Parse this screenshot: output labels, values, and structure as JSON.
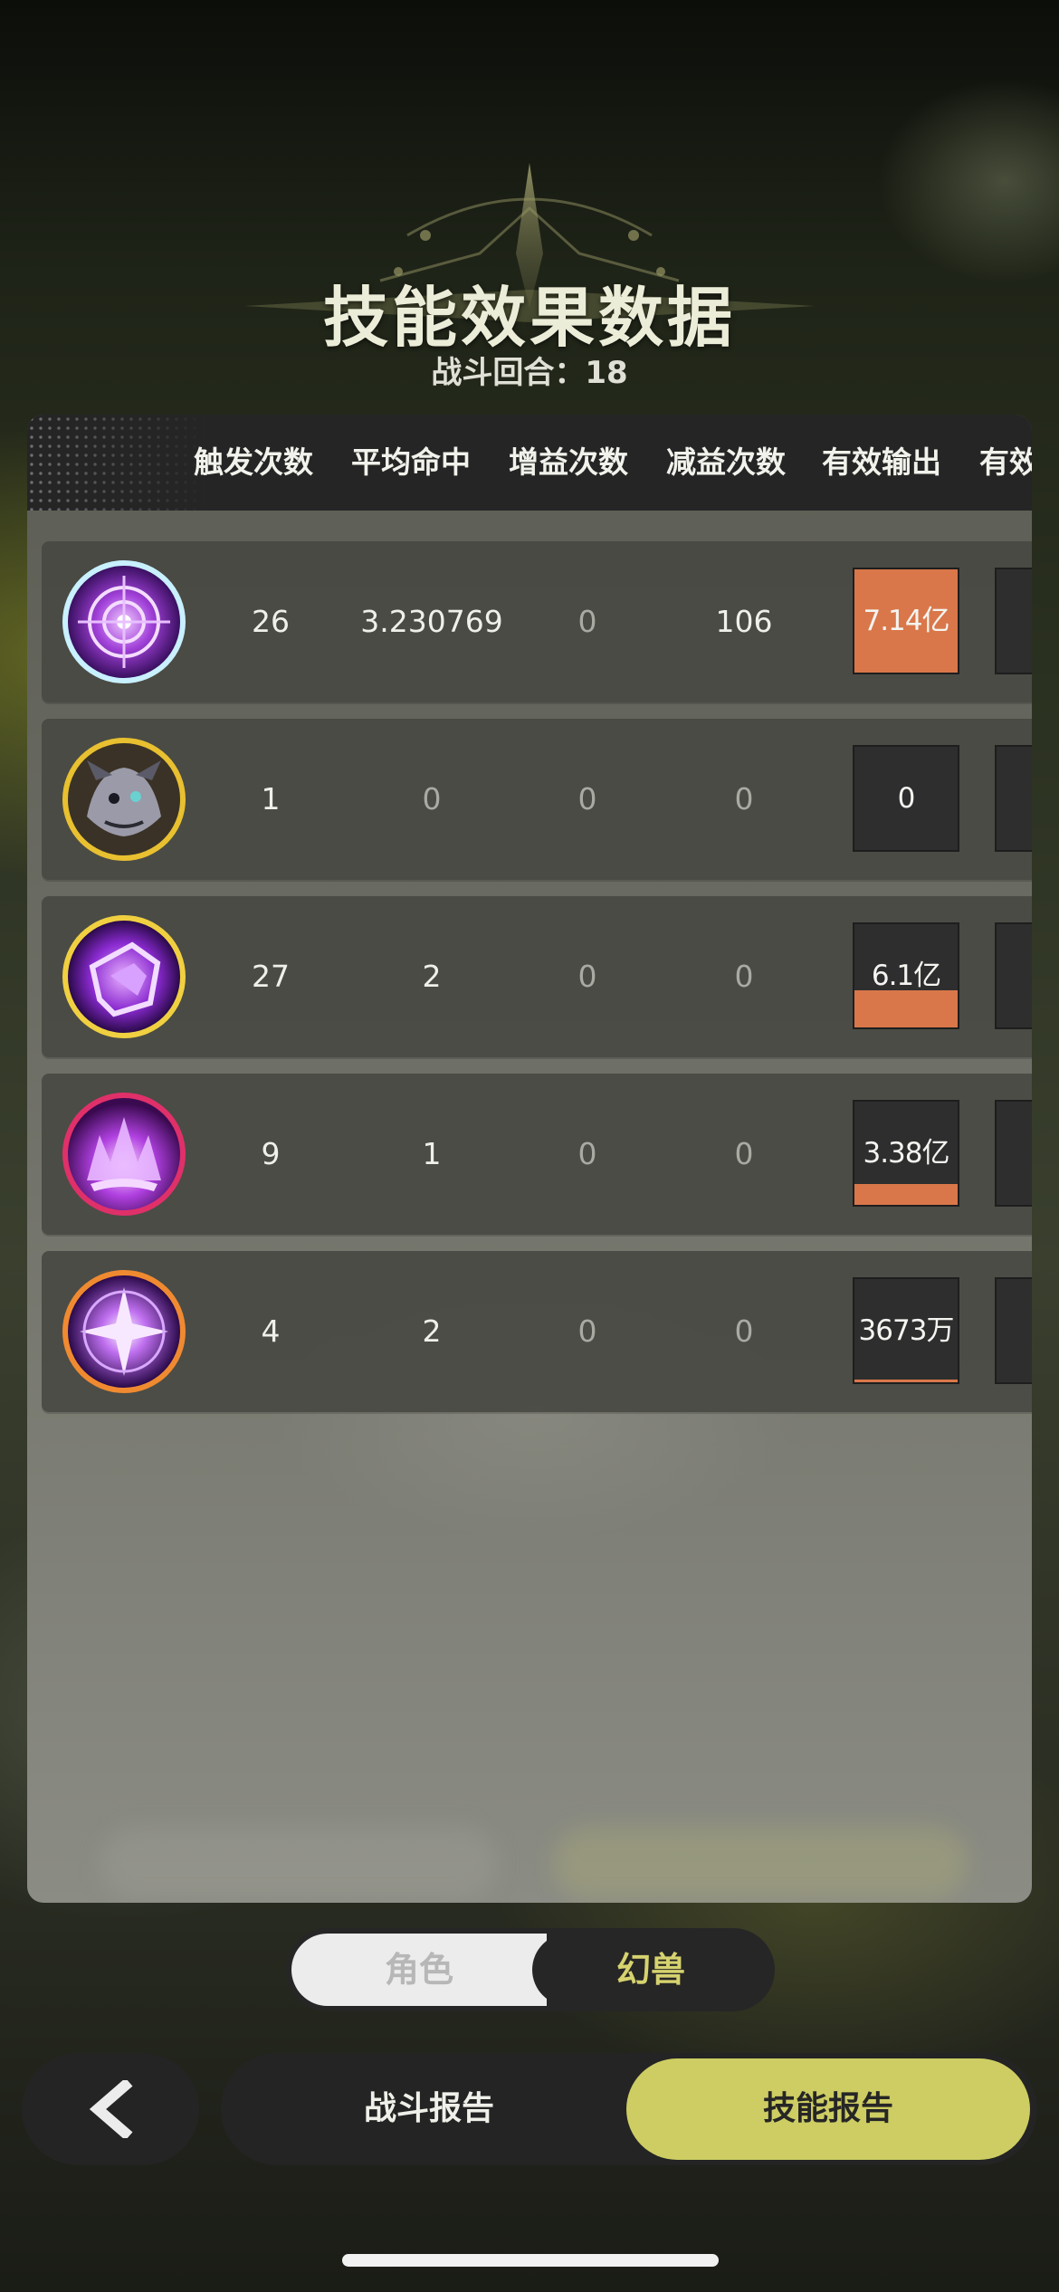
{
  "header": {
    "title": "技能效果数据",
    "round_label": "战斗回合：18"
  },
  "table": {
    "columns": [
      "触发次数",
      "平均命中",
      "增益次数",
      "减益次数",
      "有效输出",
      "有效"
    ],
    "rows": [
      {
        "icon": "arcane-vortex-icon",
        "trigger": "26",
        "avg_hit": "3.230769",
        "buff": "0",
        "debuff": "106",
        "output": "7.14亿",
        "output_fill": 1.0
      },
      {
        "icon": "shadow-beast-icon",
        "trigger": "1",
        "avg_hit": "0",
        "buff": "0",
        "debuff": "0",
        "output": "0",
        "output_fill": 0.0
      },
      {
        "icon": "violet-slash-icon",
        "trigger": "27",
        "avg_hit": "2",
        "buff": "0",
        "debuff": "0",
        "output": "6.1亿",
        "output_fill": 0.36
      },
      {
        "icon": "violet-flame-icon",
        "trigger": "9",
        "avg_hit": "1",
        "buff": "0",
        "debuff": "0",
        "output": "3.38亿",
        "output_fill": 0.2
      },
      {
        "icon": "star-burst-icon",
        "trigger": "4",
        "avg_hit": "2",
        "buff": "0",
        "debuff": "0",
        "output": "3673万",
        "output_fill": 0.03
      }
    ]
  },
  "toggle": {
    "left_label": "角色",
    "right_label": "幻兽",
    "selected": "幻兽"
  },
  "nav": {
    "back_icon": "chevron-left-icon",
    "battle_report": "战斗报告",
    "skill_report": "技能报告",
    "active": "技能报告"
  },
  "colors": {
    "accent": "#cdcd63",
    "output_bar": "#d9774a"
  }
}
